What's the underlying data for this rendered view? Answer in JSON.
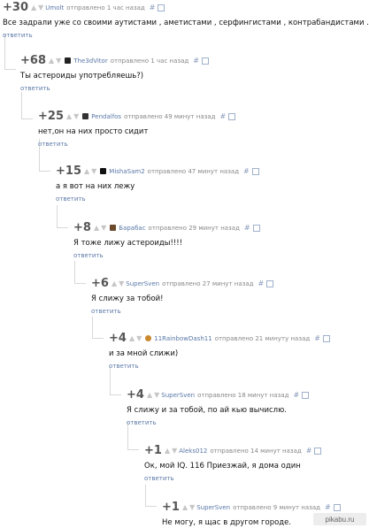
{
  "reply_label": "ответить",
  "vote_up_icon": "triangle-up",
  "vote_down_icon": "triangle-down",
  "comments": [
    {
      "rating": "+30",
      "author": "Umolt",
      "time": "отправлено 1 час назад",
      "hash": "#",
      "text": "Все задрали уже со своими аутистами , аметистами , серфингистами , контрабандистами ..",
      "avatar": "none"
    },
    {
      "rating": "+68",
      "author": "The3dVitor",
      "time": "отправлено 1 час назад",
      "hash": "#",
      "text": "Ты астероиды употребляешь?)",
      "avatar": "#222222"
    },
    {
      "rating": "+25",
      "author": "Pendalfos",
      "time": "отправлено 49 минут назад",
      "hash": "#",
      "text": "нет,он на них просто сидит",
      "avatar": "#333333"
    },
    {
      "rating": "+15",
      "author": "MishaSam2",
      "time": "отправлено 47 минут назад",
      "hash": "#",
      "text": "а я вот на них лежу",
      "avatar": "#111111"
    },
    {
      "rating": "+8",
      "author": "Барабас",
      "time": "отправлено 29 минут назад",
      "hash": "#",
      "text": "Я тоже лижу астероиды!!!!",
      "avatar": "#6b4a2b"
    },
    {
      "rating": "+6",
      "author": "SuperSven",
      "time": "отправлено 27 минут назад",
      "hash": "#",
      "text": "Я слижу за тобой!",
      "avatar": "none"
    },
    {
      "rating": "+4",
      "author": "11RainbowDash11",
      "time": "отправлено 21 минуту назад",
      "hash": "#",
      "text": "и за мной слижи)",
      "avatar": "#c9892e"
    },
    {
      "rating": "+4",
      "author": "SuperSven",
      "time": "отправлено 18 минут назад",
      "hash": "#",
      "text": "Я слижу и за тобой, по ай кью вычислю.",
      "avatar": "none"
    },
    {
      "rating": "+1",
      "author": "Aleks012",
      "time": "отправлено 14 минут назад",
      "hash": "#",
      "text": "Ок, мой IQ. 116 Приезжай, я дома один",
      "avatar": "none"
    },
    {
      "rating": "+1",
      "author": "SuperSven",
      "time": "отправлено 9 минут назад",
      "hash": "#",
      "text": "Не могу, я щас в другом городе.",
      "avatar": "none"
    }
  ],
  "watermark": "pikabu.ru"
}
